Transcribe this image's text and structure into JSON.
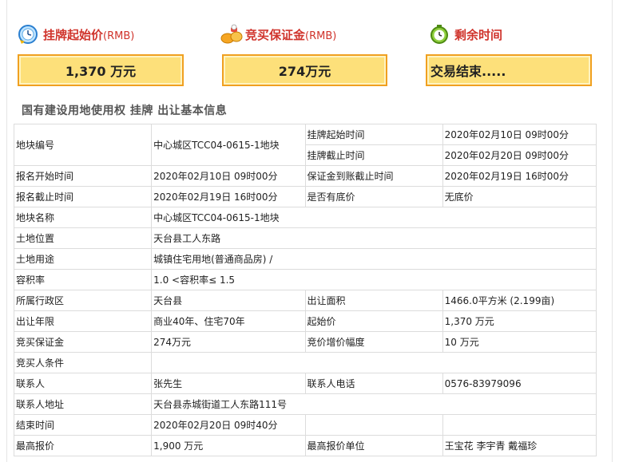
{
  "header": {
    "start_price_label": "挂牌起始价",
    "start_price_unit": "(RMB)",
    "deposit_label": "竞买保证金",
    "deposit_unit": "(RMB)",
    "remaining_label": "剩余时间",
    "start_price_value": "1,370 万元",
    "deposit_value": "274万元",
    "remaining_value": "交易结束....."
  },
  "section_title": "国有建设用地使用权 挂牌 出让基本信息",
  "table": {
    "parcel_no_label": "地块编号",
    "parcel_no_value": "中心城区TCC04-0615-1地块",
    "listing_start_label": "挂牌起始时间",
    "listing_start_value": "2020年02月10日 09时00分",
    "listing_end_label": "挂牌截止时间",
    "listing_end_value": "2020年02月20日 09时00分",
    "reg_start_label": "报名开始时间",
    "reg_start_value": "2020年02月10日 09时00分",
    "deposit_deadline_label": "保证金到账截止时间",
    "deposit_deadline_value": "2020年02月19日 16时00分",
    "reg_end_label": "报名截止时间",
    "reg_end_value": "2020年02月19日 16时00分",
    "reserve_label": "是否有底价",
    "reserve_value": "无底价",
    "parcel_name_label": "地块名称",
    "parcel_name_value": "中心城区TCC04-0615-1地块",
    "location_label": "土地位置",
    "location_value": "天台县工人东路",
    "use_label": "土地用途",
    "use_value": "城镇住宅用地(普通商品房) /",
    "far_label": "容积率",
    "far_value": "1.0 <容积率≤ 1.5",
    "district_label": "所属行政区",
    "district_value": "天台县",
    "area_label": "出让面积",
    "area_value": "1466.0平方米 (2.199亩)",
    "term_label": "出让年限",
    "term_value": "商业40年、住宅70年",
    "start_price_label": "起始价",
    "start_price_value": "1,370 万元",
    "deposit_label": "竞买保证金",
    "deposit_value": "274万元",
    "increment_label": "竞价增价幅度",
    "increment_value": "10 万元",
    "bidder_cond_label": "竞买人条件",
    "bidder_cond_value": "",
    "contact_label": "联系人",
    "contact_value": "张先生",
    "phone_label": "联系人电话",
    "phone_value": "0576-83979096",
    "address_label": "联系人地址",
    "address_value": "天台县赤城街道工人东路111号",
    "end_time_label": "结束时间",
    "end_time_value": "2020年02月20日 09时40分",
    "top_bid_label": "最高报价",
    "top_bid_value": "1,900 万元",
    "top_bidder_label": "最高报价单位",
    "top_bidder_value": "王宝花 李宇青 戴福珍"
  }
}
